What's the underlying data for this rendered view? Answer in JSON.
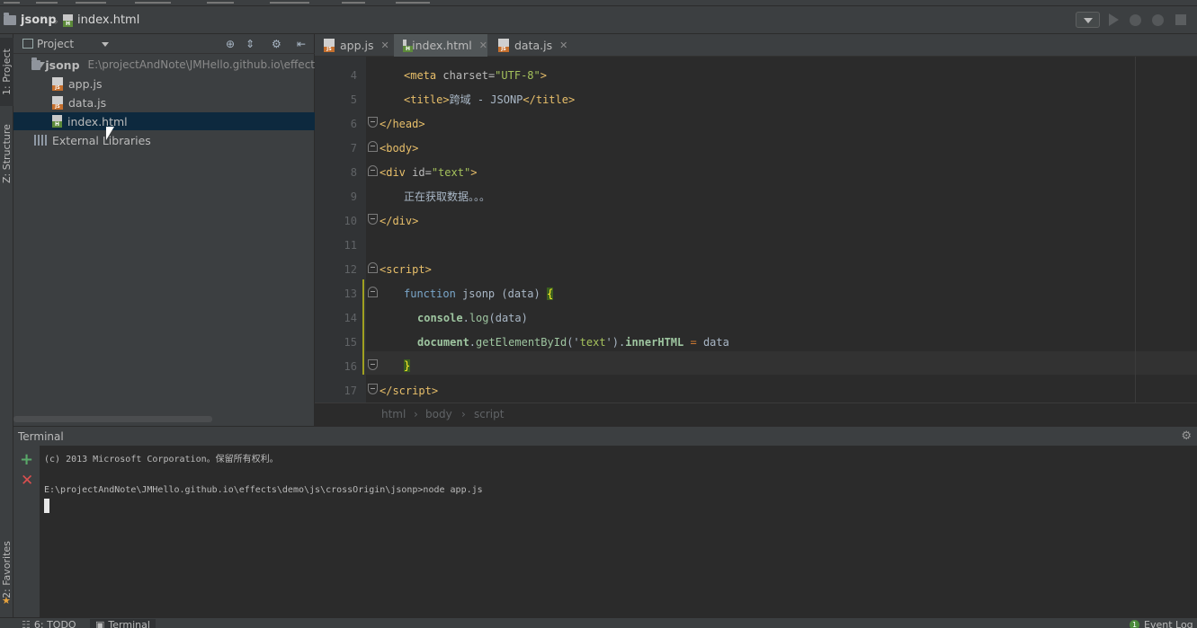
{
  "navbar": {
    "project": "jsonp",
    "file": "index.html"
  },
  "left_strip": {
    "project": "1: Project",
    "structure": "Z: Structure",
    "favorites": "2: Favorites"
  },
  "project_panel": {
    "title": "Project",
    "root": {
      "name": "jsonp",
      "path": "E:\\projectAndNote\\JMHello.github.io\\effect"
    },
    "files": [
      "app.js",
      "data.js",
      "index.html"
    ],
    "selected": "index.html",
    "external": "External Libraries"
  },
  "tabs": [
    {
      "label": "app.js",
      "icon": "js-file-icon",
      "active": false
    },
    {
      "label": "index.html",
      "icon": "html-file-icon",
      "active": true
    },
    {
      "label": "data.js",
      "icon": "js-file-icon",
      "active": false
    }
  ],
  "editor": {
    "line_numbers": [
      "4",
      "5",
      "6",
      "7",
      "8",
      "9",
      "10",
      "11",
      "12",
      "13",
      "14",
      "15",
      "16",
      "17"
    ],
    "lines": {
      "l4": {
        "a": "<",
        "b": "meta",
        "c": " charset=",
        "d": "\"UTF-8\"",
        "e": ">"
      },
      "l5": {
        "a": "<",
        "b": "title",
        "c": ">",
        "d": "跨域 - JSONP",
        "e": "</",
        "f": "title",
        "g": ">"
      },
      "l6": {
        "a": "</",
        "b": "head",
        "c": ">"
      },
      "l7": {
        "a": "<",
        "b": "body",
        "c": ">"
      },
      "l8": {
        "a": "<",
        "b": "div",
        "c": " id=",
        "d": "\"text\"",
        "e": ">"
      },
      "l9": {
        "a": "正在获取数据。。。"
      },
      "l10": {
        "a": "</",
        "b": "div",
        "c": ">"
      },
      "l12": {
        "a": "<",
        "b": "script",
        "c": ">"
      },
      "l13": {
        "a": "function",
        "b": " jsonp ",
        "c": "(data) ",
        "d": "{"
      },
      "l14": {
        "a": "console",
        "b": ".",
        "c": "log",
        "d": "(data)"
      },
      "l15": {
        "a": "document",
        "b": ".",
        "c": "getElementById",
        "d": "('",
        "e": "text",
        "f": "').",
        "g": "innerHTML",
        "h": " = ",
        "i": "data"
      },
      "l16": {
        "a": "}"
      },
      "l17": {
        "a": "</",
        "b": "script",
        "c": ">"
      }
    },
    "breadcrumb": [
      "html",
      "body",
      "script"
    ],
    "colors": {
      "tag": "#e8bf6a",
      "string": "#a5c25c",
      "keyword": "#cc7832",
      "bracket_highlight": "#3b5f1f"
    }
  },
  "terminal": {
    "title": "Terminal",
    "lines": [
      "(c) 2013 Microsoft Corporation。保留所有权利。",
      "",
      "E:\\projectAndNote\\JMHello.github.io\\effects\\demo\\js\\crossOrigin\\jsonp>node app.js"
    ]
  },
  "statusbar": {
    "todo": "6: TODO",
    "terminal": "Terminal",
    "event_log": "Event Log",
    "event_count": "1"
  }
}
